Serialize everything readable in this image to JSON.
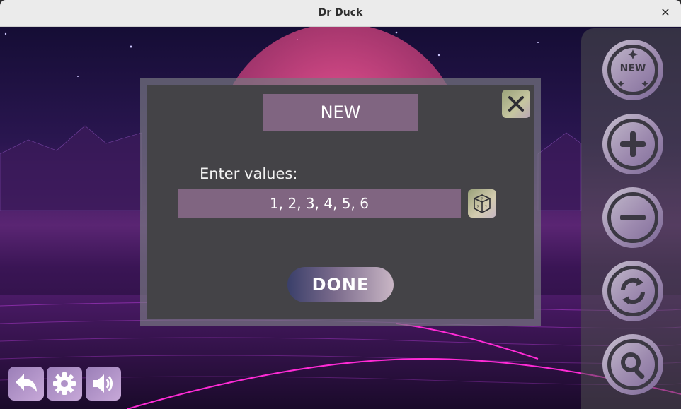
{
  "window": {
    "title": "Dr Duck",
    "close_glyph": "✕"
  },
  "dialog": {
    "title": "NEW",
    "prompt": "Enter values:",
    "values": "1, 2, 3, 4, 5, 6",
    "done_label": "DONE",
    "close_icon": "close-icon",
    "dice_icon": "dice-icon"
  },
  "side_panel": {
    "buttons": [
      {
        "id": "new",
        "label": "NEW",
        "icon": "new-sparkle-icon"
      },
      {
        "id": "add",
        "icon": "plus-icon"
      },
      {
        "id": "remove",
        "icon": "minus-icon"
      },
      {
        "id": "reset",
        "icon": "refresh-icon"
      },
      {
        "id": "search",
        "icon": "search-icon"
      }
    ]
  },
  "bottom_bar": {
    "buttons": [
      {
        "id": "back",
        "icon": "back-arrow-icon"
      },
      {
        "id": "settings",
        "icon": "gear-icon"
      },
      {
        "id": "sound",
        "icon": "speaker-icon"
      }
    ]
  },
  "colors": {
    "dialog_bg": "#444347",
    "field_bg": "#806581",
    "accent_purple": "#9d8aaf",
    "background_top": "#150d35",
    "background_horizon": "#5a2573"
  }
}
